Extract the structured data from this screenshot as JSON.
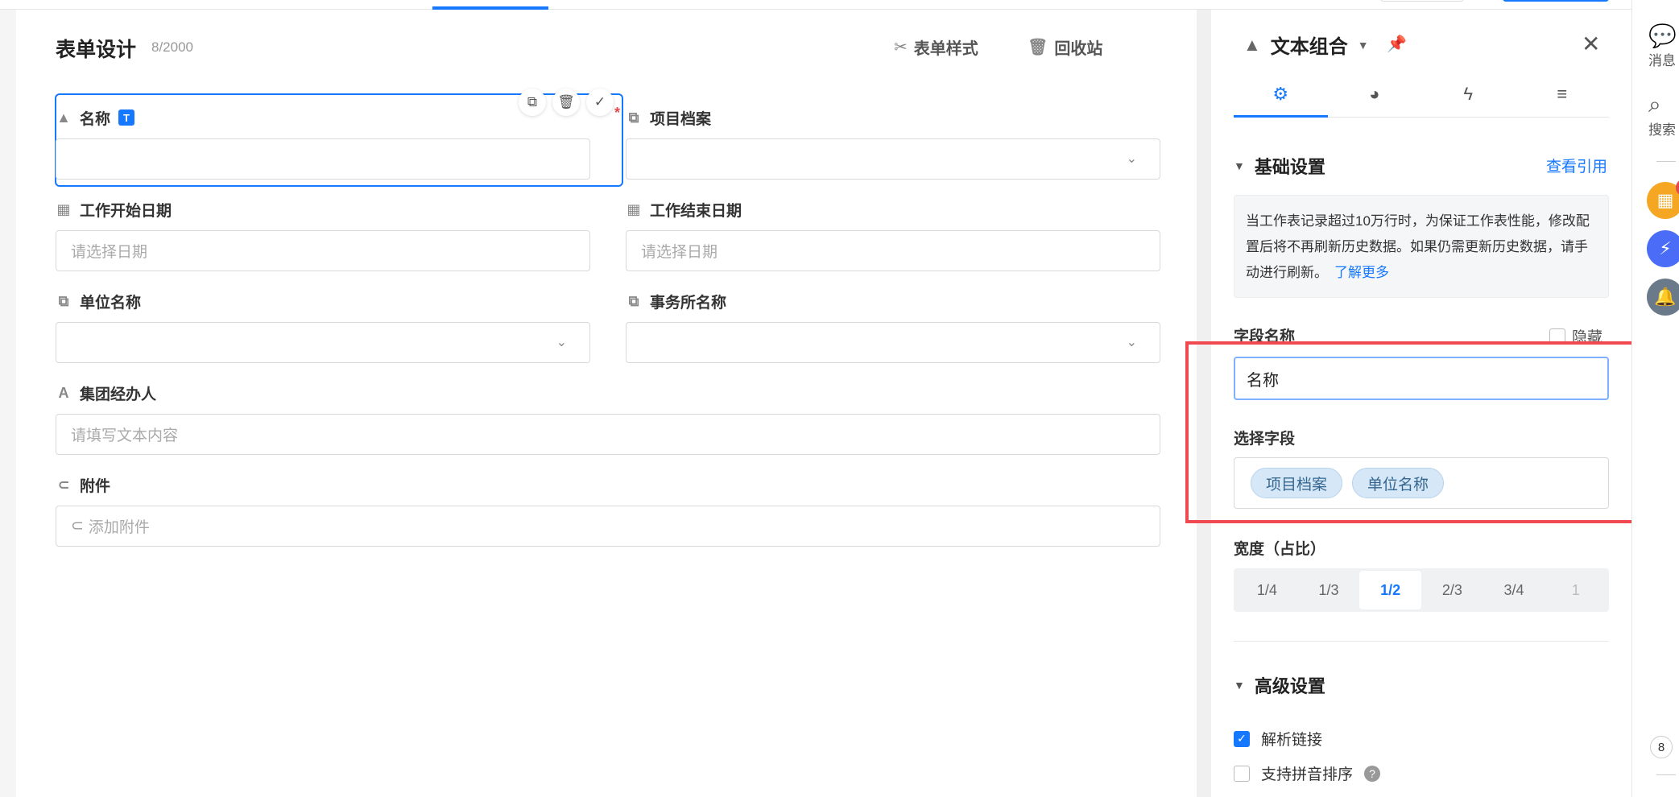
{
  "form": {
    "title": "表单设计",
    "count": "8/2000",
    "style_label": "表单样式",
    "recycle_label": "回收站",
    "fields": {
      "name": {
        "label": "名称",
        "badge": "T",
        "value": ""
      },
      "project": {
        "label": "项目档案",
        "required": "*",
        "value": ""
      },
      "start_date": {
        "label": "工作开始日期",
        "placeholder": "请选择日期"
      },
      "end_date": {
        "label": "工作结束日期",
        "placeholder": "请选择日期"
      },
      "unit": {
        "label": "单位名称",
        "value": ""
      },
      "office": {
        "label": "事务所名称",
        "value": ""
      },
      "agent": {
        "label": "集团经办人",
        "placeholder": "请填写文本内容"
      },
      "attachment": {
        "label": "附件",
        "placeholder": "添加附件"
      }
    }
  },
  "panel": {
    "title": "文本组合",
    "tabs": [
      "settings-icon",
      "palette-icon",
      "lightning-icon",
      "sort-icon"
    ],
    "basic": {
      "title": "基础设置",
      "link": "查看引用",
      "notice": "当工作表记录超过10万行时，为保证工作表性能，修改配置后将不再刷新历史数据。如果仍需更新历史数据，请手动进行刷新。",
      "notice_link": "了解更多",
      "field_name_label": "字段名称",
      "hide_label": "隐藏",
      "field_name_value": "名称",
      "select_field_label": "选择字段",
      "selected_fields": [
        "项目档案",
        "单位名称"
      ],
      "width_label": "宽度（占比）",
      "width_options": [
        "1/4",
        "1/3",
        "1/2",
        "2/3",
        "3/4",
        "1"
      ],
      "width_selected": "1/2"
    },
    "advanced": {
      "title": "高级设置",
      "parse_link": "解析链接",
      "pinyin_sort": "支持拼音排序"
    }
  },
  "rightbar": {
    "messages": "消息",
    "search": "搜索",
    "badge": "8",
    "page_num": "8"
  },
  "colors": {
    "accent": "#1677ff",
    "highlight": "#f0494f",
    "tag_bg": "#d6e8f8"
  }
}
